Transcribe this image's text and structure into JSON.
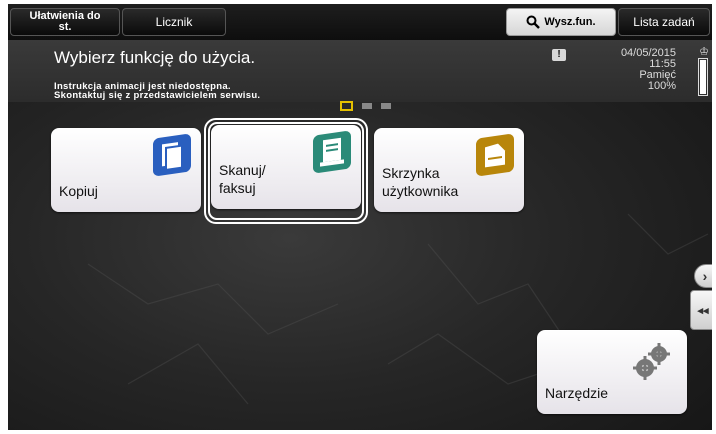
{
  "topbar": {
    "accessibility_label": "Ułatwienia do st.",
    "counter_label": "Licznik",
    "search_label": "Wysz.fun.",
    "joblist_label": "Lista zadań"
  },
  "message": {
    "title": "Wybierz funkcję do użycia.",
    "line1": "Instrukcja animacji jest niedostępna.",
    "line2": "Skontaktuj się z przedstawicielem serwisu.",
    "warning_glyph": "!"
  },
  "status": {
    "date": "04/05/2015",
    "time": "11:55",
    "memory_label": "Pamięć",
    "memory_value": "100%",
    "memory_fraction": 1.0
  },
  "pager": {
    "pages": 3,
    "active": 0
  },
  "tiles": {
    "copy": {
      "label": "Kopiuj",
      "icon": "copy-icon",
      "color": "#2a5fbf"
    },
    "scan": {
      "label1": "Skanuj/",
      "label2": "faksuj",
      "icon": "scan-icon",
      "color": "#2a8a78"
    },
    "box": {
      "label1": "Skrzynka",
      "label2": "użytkownika",
      "icon": "box-icon",
      "color": "#b8860b"
    },
    "utility": {
      "label": "Narzędzie",
      "icon": "gear-icon",
      "color": "#777777"
    }
  },
  "nav": {
    "next_glyph": "›",
    "collapse_glyph": "◂◂"
  }
}
